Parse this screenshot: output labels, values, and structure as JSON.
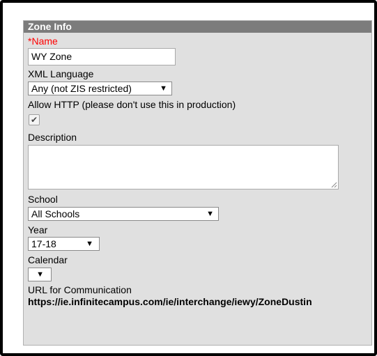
{
  "panel": {
    "title": "Zone Info"
  },
  "fields": {
    "name": {
      "required_mark": "*",
      "label": "Name",
      "value": "WY Zone"
    },
    "xml_language": {
      "label": "XML Language",
      "selected": "Any (not ZIS restricted)"
    },
    "allow_http": {
      "label": "Allow HTTP (please don't use this in production)",
      "checked": true
    },
    "description": {
      "label": "Description",
      "value": ""
    },
    "school": {
      "label": "School",
      "selected": "All Schools"
    },
    "year": {
      "label": "Year",
      "selected": "17-18"
    },
    "calendar": {
      "label": "Calendar",
      "selected": ""
    },
    "url": {
      "label": "URL for Communication",
      "value": "https://ie.infinitecampus.com/ie/interchange/iewy/ZoneDustin"
    }
  },
  "icons": {
    "dropdown": "▼",
    "check": "✔"
  }
}
